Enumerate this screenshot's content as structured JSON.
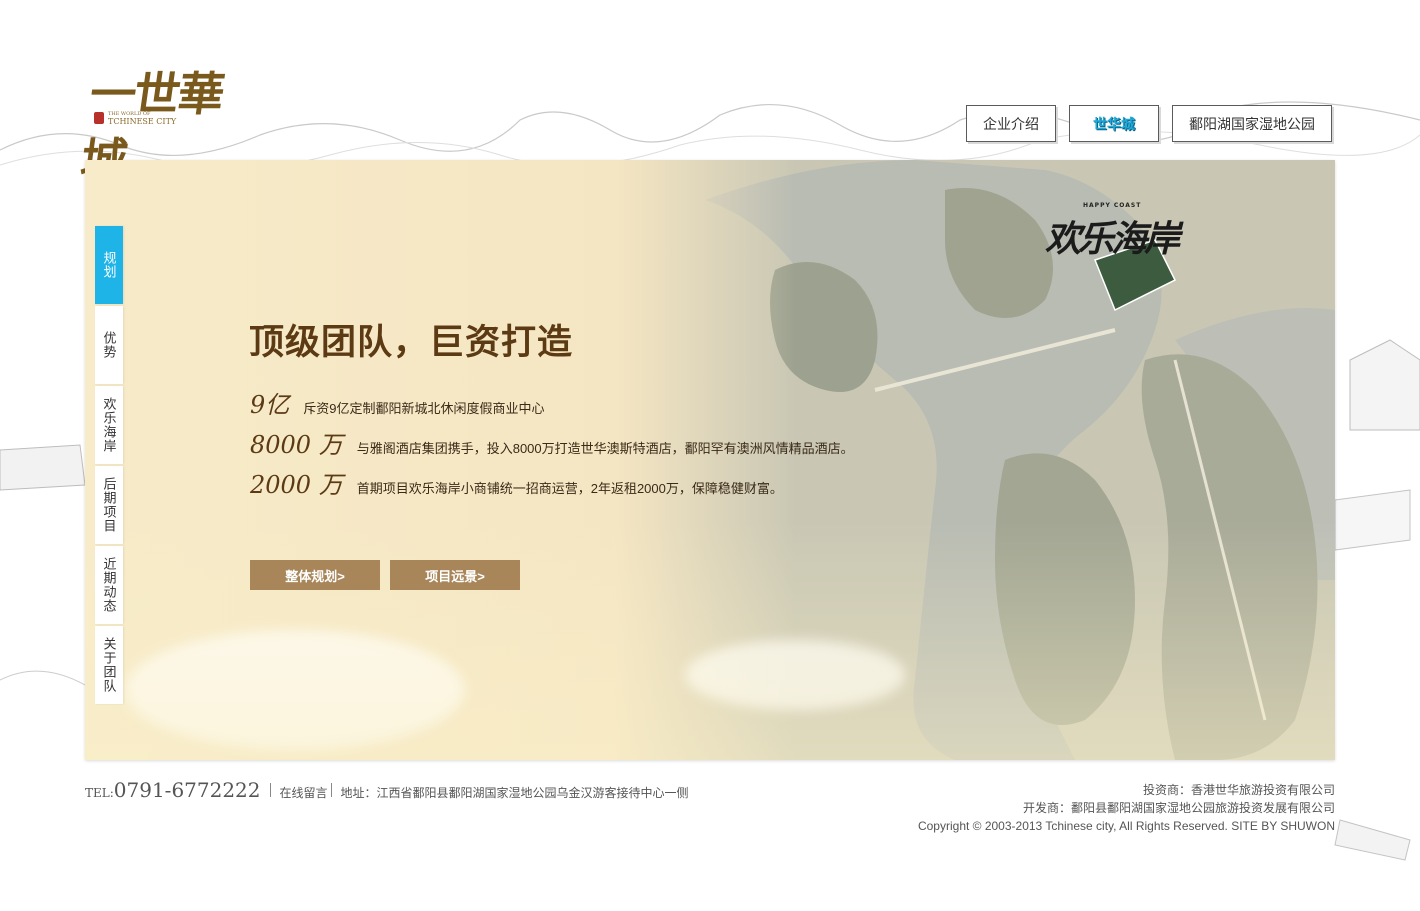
{
  "logo": {
    "calligraphy": "一世華城",
    "english_top": "THE WORLD OF",
    "english": "TCHINESE CITY"
  },
  "topnav": {
    "items": [
      {
        "label": "企业介绍"
      },
      {
        "label": "世华城",
        "active": true
      },
      {
        "label": "鄱阳湖国家湿地公园"
      }
    ]
  },
  "banner": {
    "brand_cn": "欢乐海岸",
    "brand_en": "HAPPY COAST",
    "headline": "顶级团队，巨资打造",
    "stats": [
      {
        "num": "9亿",
        "desc": "斥资9亿定制鄱阳新城北休闲度假商业中心"
      },
      {
        "num": "8000 万",
        "desc": "与雅阁酒店集团携手，投入8000万打造世华澳斯特酒店，鄱阳罕有澳洲风情精品酒店。"
      },
      {
        "num": "2000 万",
        "desc": "首期项目欢乐海岸小商铺统一招商运营，2年返租2000万，保障稳健财富。"
      }
    ],
    "buttons": [
      {
        "label": "整体规划>"
      },
      {
        "label": "项目远景>"
      }
    ]
  },
  "sidenav": {
    "items": [
      {
        "label": "规划",
        "active": true
      },
      {
        "label": "优势"
      },
      {
        "label": "欢乐海岸"
      },
      {
        "label": "后期项目"
      },
      {
        "label": "近期动态"
      },
      {
        "label": "关于团队"
      }
    ]
  },
  "footer": {
    "tel_label": "TEL:",
    "tel": "0791-6772222",
    "message": "在线留言",
    "address": "地址：江西省鄱阳县鄱阳湖国家湿地公园乌金汉游客接待中心一侧",
    "investor": "投资商：香港世华旅游投资有限公司",
    "developer": "开发商：鄱阳县鄱阳湖国家湿地公园旅游投资发展有限公司",
    "copyright": "Copyright © 2003-2013 Tchinese city, All Rights Reserved.   SITE BY SHUWON"
  },
  "colors": {
    "accent_blue": "#1fb4e8",
    "headline_brown": "#5c3a14",
    "button_tan": "#a8865a"
  }
}
